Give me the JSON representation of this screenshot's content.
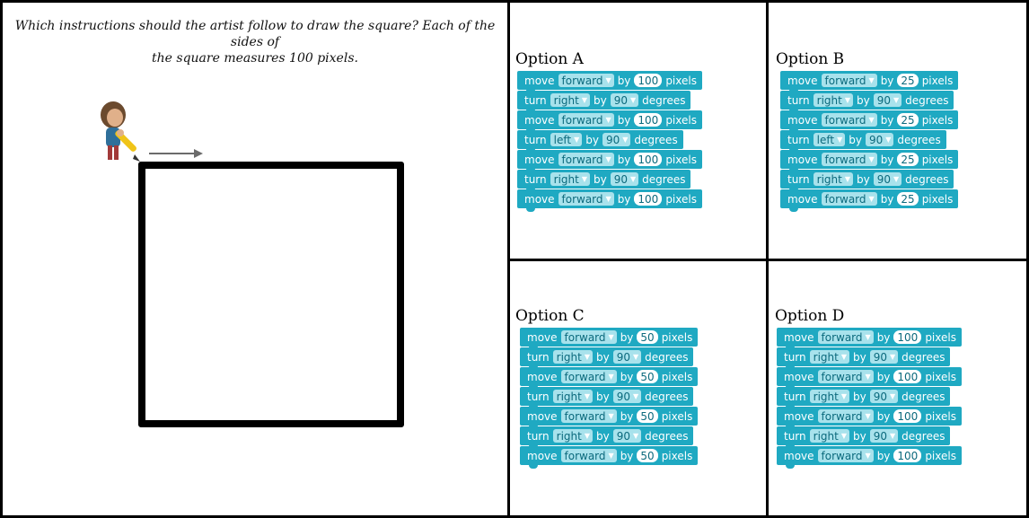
{
  "question": {
    "line1": "Which instructions should the artist follow to draw the square? Each of the sides of",
    "line2": "the square measures 100 pixels."
  },
  "icons": {
    "artist": "artist-character-icon",
    "arrow": "direction-arrow-icon"
  },
  "colors": {
    "block": "#1fa9c2",
    "dropdown": "#a8e2ec",
    "square": "#000000"
  },
  "options": [
    {
      "title": "Option A",
      "blocks": [
        {
          "kind": "move",
          "verb": "move",
          "dir": "forward",
          "by": "by",
          "value": "100",
          "unit": "pixels"
        },
        {
          "kind": "turn",
          "verb": "turn",
          "dir": "right",
          "by": "by",
          "value": "90",
          "unit": "degrees"
        },
        {
          "kind": "move",
          "verb": "move",
          "dir": "forward",
          "by": "by",
          "value": "100",
          "unit": "pixels"
        },
        {
          "kind": "turn",
          "verb": "turn",
          "dir": "left",
          "by": "by",
          "value": "90",
          "unit": "degrees"
        },
        {
          "kind": "move",
          "verb": "move",
          "dir": "forward",
          "by": "by",
          "value": "100",
          "unit": "pixels"
        },
        {
          "kind": "turn",
          "verb": "turn",
          "dir": "right",
          "by": "by",
          "value": "90",
          "unit": "degrees"
        },
        {
          "kind": "move",
          "verb": "move",
          "dir": "forward",
          "by": "by",
          "value": "100",
          "unit": "pixels"
        }
      ]
    },
    {
      "title": "Option B",
      "blocks": [
        {
          "kind": "move",
          "verb": "move",
          "dir": "forward",
          "by": "by",
          "value": "25",
          "unit": "pixels"
        },
        {
          "kind": "turn",
          "verb": "turn",
          "dir": "right",
          "by": "by",
          "value": "90",
          "unit": "degrees"
        },
        {
          "kind": "move",
          "verb": "move",
          "dir": "forward",
          "by": "by",
          "value": "25",
          "unit": "pixels"
        },
        {
          "kind": "turn",
          "verb": "turn",
          "dir": "left",
          "by": "by",
          "value": "90",
          "unit": "degrees"
        },
        {
          "kind": "move",
          "verb": "move",
          "dir": "forward",
          "by": "by",
          "value": "25",
          "unit": "pixels"
        },
        {
          "kind": "turn",
          "verb": "turn",
          "dir": "right",
          "by": "by",
          "value": "90",
          "unit": "degrees"
        },
        {
          "kind": "move",
          "verb": "move",
          "dir": "forward",
          "by": "by",
          "value": "25",
          "unit": "pixels"
        }
      ]
    },
    {
      "title": "Option C",
      "blocks": [
        {
          "kind": "move",
          "verb": "move",
          "dir": "forward",
          "by": "by",
          "value": "50",
          "unit": "pixels"
        },
        {
          "kind": "turn",
          "verb": "turn",
          "dir": "right",
          "by": "by",
          "value": "90",
          "unit": "degrees"
        },
        {
          "kind": "move",
          "verb": "move",
          "dir": "forward",
          "by": "by",
          "value": "50",
          "unit": "pixels"
        },
        {
          "kind": "turn",
          "verb": "turn",
          "dir": "right",
          "by": "by",
          "value": "90",
          "unit": "degrees"
        },
        {
          "kind": "move",
          "verb": "move",
          "dir": "forward",
          "by": "by",
          "value": "50",
          "unit": "pixels"
        },
        {
          "kind": "turn",
          "verb": "turn",
          "dir": "right",
          "by": "by",
          "value": "90",
          "unit": "degrees"
        },
        {
          "kind": "move",
          "verb": "move",
          "dir": "forward",
          "by": "by",
          "value": "50",
          "unit": "pixels"
        }
      ]
    },
    {
      "title": "Option D",
      "blocks": [
        {
          "kind": "move",
          "verb": "move",
          "dir": "forward",
          "by": "by",
          "value": "100",
          "unit": "pixels"
        },
        {
          "kind": "turn",
          "verb": "turn",
          "dir": "right",
          "by": "by",
          "value": "90",
          "unit": "degrees"
        },
        {
          "kind": "move",
          "verb": "move",
          "dir": "forward",
          "by": "by",
          "value": "100",
          "unit": "pixels"
        },
        {
          "kind": "turn",
          "verb": "turn",
          "dir": "right",
          "by": "by",
          "value": "90",
          "unit": "degrees"
        },
        {
          "kind": "move",
          "verb": "move",
          "dir": "forward",
          "by": "by",
          "value": "100",
          "unit": "pixels"
        },
        {
          "kind": "turn",
          "verb": "turn",
          "dir": "right",
          "by": "by",
          "value": "90",
          "unit": "degrees"
        },
        {
          "kind": "move",
          "verb": "move",
          "dir": "forward",
          "by": "by",
          "value": "100",
          "unit": "pixels"
        }
      ]
    }
  ]
}
